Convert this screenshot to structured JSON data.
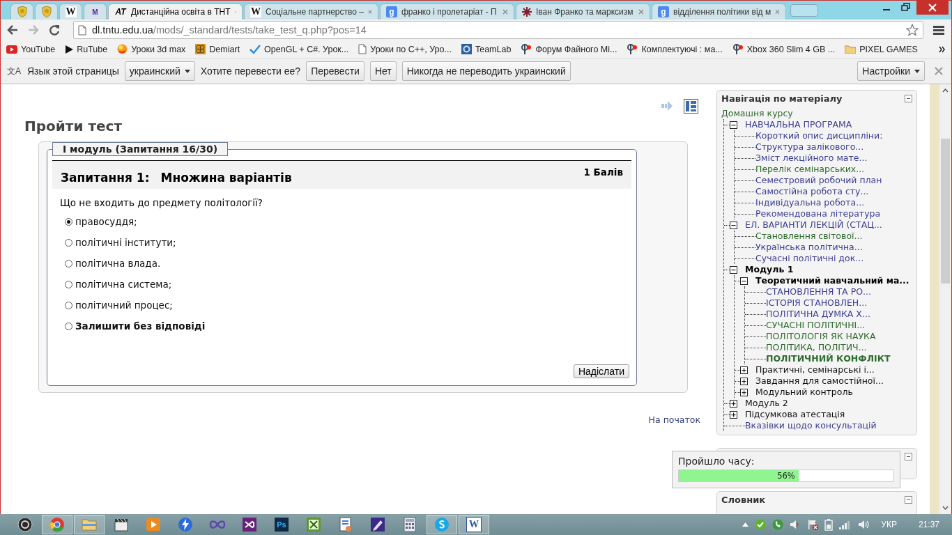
{
  "tabs": [
    {
      "kind": "shield",
      "selected": false
    },
    {
      "kind": "shield",
      "selected": false
    },
    {
      "kind": "wiki",
      "icon_text": "W",
      "selected": false
    },
    {
      "kind": "cap",
      "icon_text": "M",
      "selected": false
    },
    {
      "kind": "site",
      "icon_text": "AT",
      "title": "Дистанційна освіта в ТНТ",
      "selected": true
    },
    {
      "kind": "wiki",
      "icon_text": "W",
      "title": "Соціальне партнерство –",
      "selected": false
    },
    {
      "kind": "google",
      "icon_text": "g",
      "title": "франко і пролетаріат - П",
      "selected": false
    },
    {
      "kind": "ornament",
      "title": "Іван Франко та марксизм",
      "selected": false
    },
    {
      "kind": "google",
      "icon_text": "g",
      "title": "відділення політики від м",
      "selected": false
    }
  ],
  "nav_buttons": [
    {
      "kind": "back",
      "disabled": false
    },
    {
      "kind": "forward",
      "disabled": true
    },
    {
      "kind": "reload",
      "disabled": false
    }
  ],
  "address": {
    "host": "dl.tntu.edu.ua",
    "path": "/mods/_standard/tests/take_test_q.php?pos=14"
  },
  "bookmarks": [
    {
      "kind": "youtube",
      "label": "YouTube"
    },
    {
      "kind": "play",
      "label": "RuTube"
    },
    {
      "kind": "ball",
      "label": "Уроки 3d max"
    },
    {
      "kind": "demiart",
      "label": "Demiart"
    },
    {
      "kind": "check",
      "label": "OpenGL + C#. Урок..."
    },
    {
      "kind": "page",
      "label": "Уроки по C++, Уро..."
    },
    {
      "kind": "teamlab",
      "label": "TeamLab"
    },
    {
      "kind": "fi",
      "label": "Форум Файного Мі..."
    },
    {
      "kind": "fi",
      "label": "Комплектуючі : ма..."
    },
    {
      "kind": "fi",
      "label": "Xbox 360 Slim 4 GB ..."
    },
    {
      "kind": "folder",
      "label": "PIXEL GAMES"
    }
  ],
  "translate_bar": {
    "icon_text": "文A",
    "prompt": "Язык этой страницы",
    "language": "украинский",
    "question": "Хотите перевести ее?",
    "buttons": [
      "Перевести",
      "Нет",
      "Никогда не переводить украинский"
    ],
    "settings": "Настройки"
  },
  "page": {
    "title": "Пройти тест",
    "legend": "І модуль (Запитання 16/30)",
    "question_number": "Запитання 1:",
    "question_type": "Множина варіантів",
    "points": "1 Балів",
    "question": "Що не входить до предмету політології?",
    "options": [
      {
        "label": "правосуддя;",
        "kind": "answer",
        "selected": true
      },
      {
        "label": "політичні інститути;",
        "kind": "answer",
        "selected": false
      },
      {
        "label": "політична влада.",
        "kind": "answer",
        "selected": false
      },
      {
        "label": "політична система;",
        "kind": "answer",
        "selected": false
      },
      {
        "label": "політичний процес;",
        "kind": "answer",
        "selected": false
      },
      {
        "label": "Залишити без відповіді",
        "kind": "skip",
        "selected": false
      }
    ],
    "submit": "Надіслати",
    "top_link": "На початок"
  },
  "navigation": {
    "title": "Навігація по матеріалу",
    "home": {
      "label": "Домашня курсу",
      "kind": "visited"
    },
    "items": [
      {
        "label": "НАВЧАЛЬНА ПРОГРАМА",
        "kind": "link",
        "expanded": true,
        "children": [
          {
            "label": "Короткий опис дисципліни:",
            "kind": "link"
          },
          {
            "label": "Структура залікового...",
            "kind": "link"
          },
          {
            "label": "Зміст лекційного мате...",
            "kind": "link"
          },
          {
            "label": "Перелік семінарських...",
            "kind": "visited"
          },
          {
            "label": "Семестровий робочий план",
            "kind": "link"
          },
          {
            "label": "Самостійна робота сту...",
            "kind": "link"
          },
          {
            "label": "Індивідуальна робота...",
            "kind": "link"
          },
          {
            "label": "Рекомендована література",
            "kind": "link"
          }
        ]
      },
      {
        "label": "ЕЛ. ВАРІАНТИ ЛЕКЦІЙ (СТАЦ...",
        "kind": "link",
        "expanded": true,
        "children": [
          {
            "label": "Становлення світової...",
            "kind": "visited"
          },
          {
            "label": "Українська політична...",
            "kind": "link"
          },
          {
            "label": "Сучасні політичні док...",
            "kind": "link"
          }
        ]
      },
      {
        "label": "Модуль 1",
        "kind": "bold",
        "expanded": true,
        "children": [
          {
            "label": "Теоретичний навчальний ма...",
            "kind": "bold",
            "expanded": true,
            "children": [
              {
                "label": "СТАНОВЛЕННЯ ТА РО...",
                "kind": "link"
              },
              {
                "label": "ІСТОРІЯ СТАНОВЛЕН...",
                "kind": "link"
              },
              {
                "label": "ПОЛІТИЧНА ДУМКА Х...",
                "kind": "link"
              },
              {
                "label": "СУЧАСНІ ПОЛІТИЧНІ...",
                "kind": "visited"
              },
              {
                "label": "ПОЛІТОЛОГІЯ ЯК НАУКА",
                "kind": "visited"
              },
              {
                "label": "ПОЛІТИКА, ПОЛІТИЧ...",
                "kind": "visited"
              },
              {
                "label": "ПОЛІТИЧНИЙ КОНФЛІКТ",
                "kind": "current"
              }
            ]
          },
          {
            "label": "Практичні, семінарські і...",
            "kind": "plain",
            "expanded": false
          },
          {
            "label": "Завдання для самостійної...",
            "kind": "plain",
            "expanded": false
          },
          {
            "label": "Модульний контроль",
            "kind": "plain",
            "expanded": false
          }
        ]
      },
      {
        "label": "Модуль 2",
        "kind": "plain",
        "expanded": false
      },
      {
        "label": "Підсумкова атестація",
        "kind": "plain",
        "expanded": false
      },
      {
        "label": "Вказівки щодо консультацій",
        "kind": "link"
      }
    ]
  },
  "timer": {
    "label": "Пройшло часу:",
    "level": 0.56,
    "reading": "56%"
  },
  "glossary": {
    "title": "Словник"
  },
  "taskbar": {
    "apps": [
      {
        "kind": "media",
        "running": false
      },
      {
        "kind": "chrome",
        "running": true
      },
      {
        "kind": "folder",
        "running": true
      },
      {
        "kind": "clapper",
        "running": false
      },
      {
        "kind": "player",
        "running": false
      },
      {
        "kind": "bolt",
        "running": false
      },
      {
        "kind": "infinity",
        "running": false
      },
      {
        "kind": "studio",
        "running": false
      },
      {
        "kind": "ps",
        "icon_text": "Ps",
        "running": false
      },
      {
        "kind": "sheet",
        "running": false
      },
      {
        "kind": "doc",
        "running": false
      },
      {
        "kind": "pen",
        "running": false
      },
      {
        "kind": "calc",
        "running": false
      },
      {
        "kind": "skype",
        "running": true
      },
      {
        "kind": "word",
        "icon_text": "W",
        "running": true
      }
    ],
    "language": "УКР",
    "time": "21:37"
  }
}
